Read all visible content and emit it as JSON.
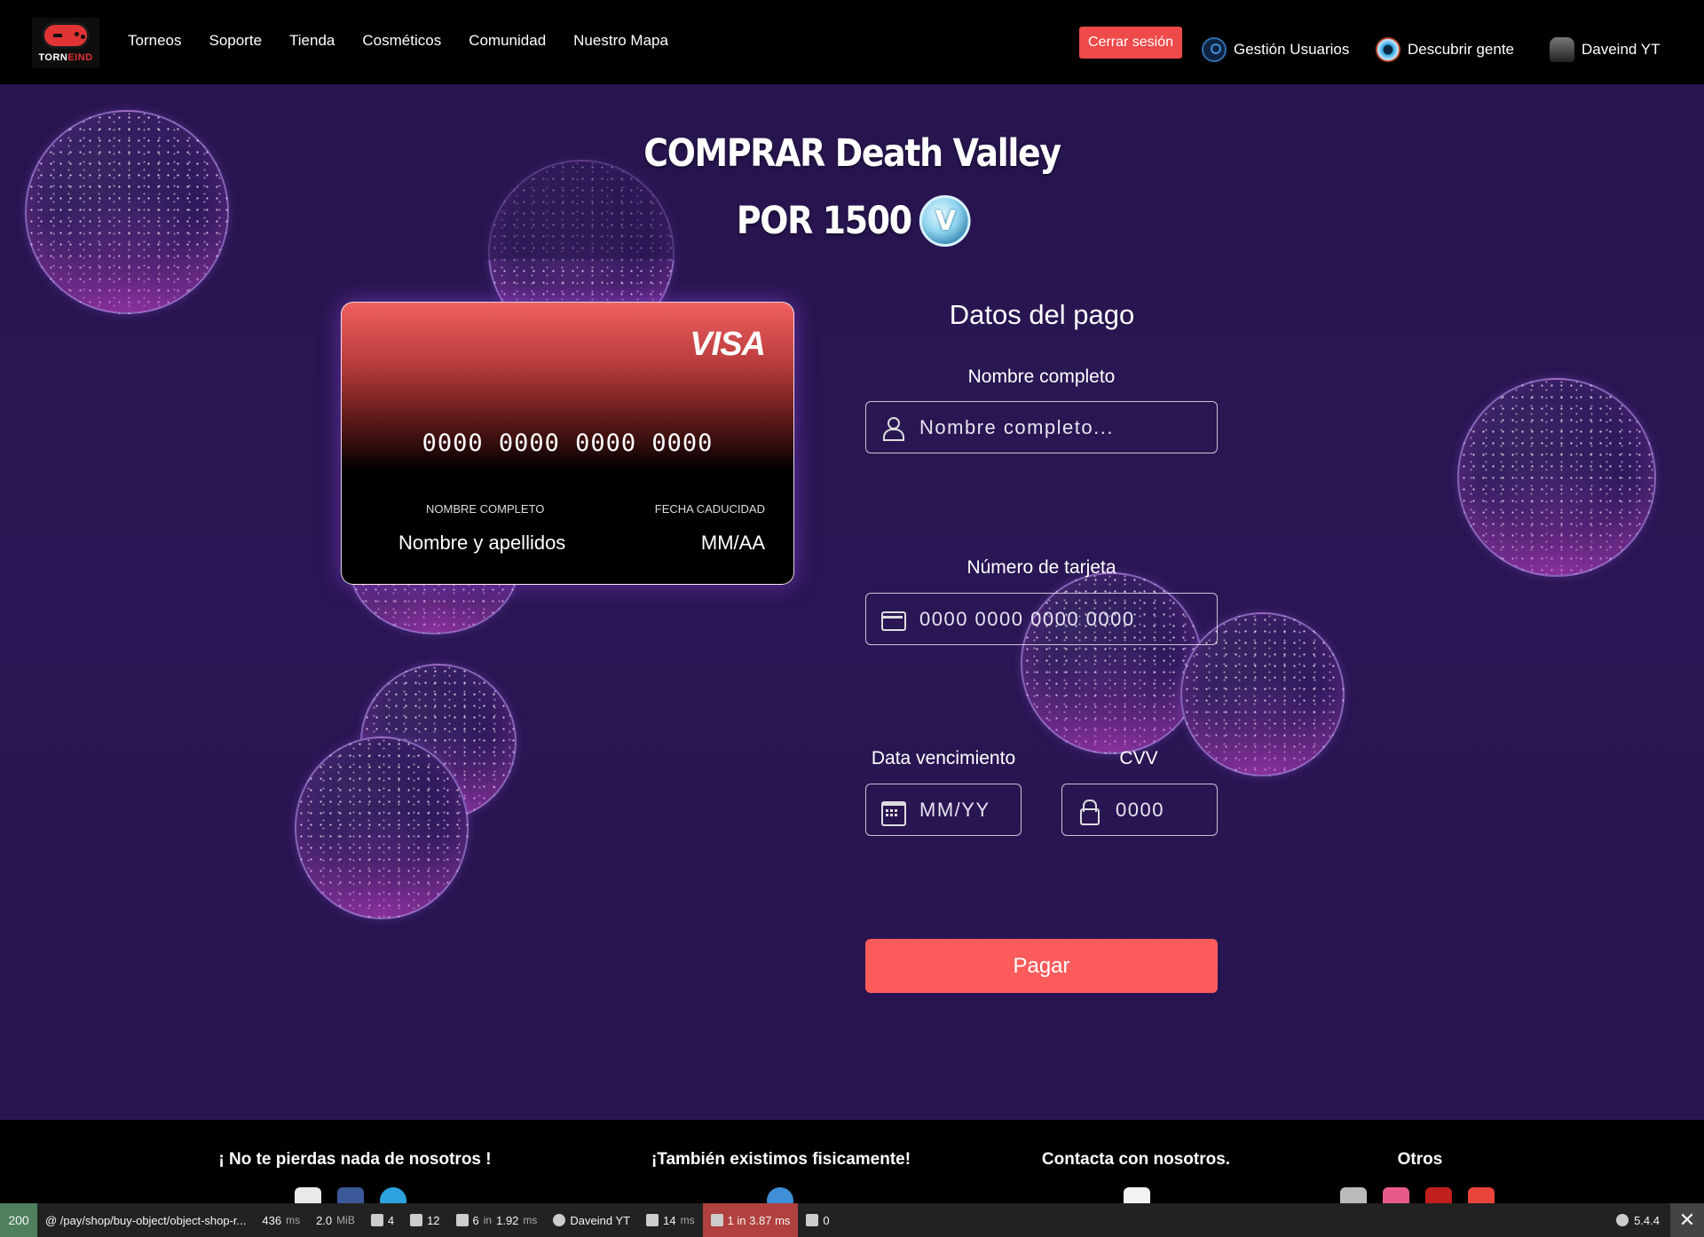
{
  "nav": {
    "logo_text_a": "TORN",
    "logo_text_b": "EIND",
    "links": [
      "Torneos",
      "Soporte",
      "Tienda",
      "Cosméticos",
      "Comunidad",
      "Nuestro Mapa"
    ],
    "logout": "Cerrar sesión",
    "manage_users": "Gestión Usuarios",
    "discover": "Descubrir gente",
    "username": "Daveind YT"
  },
  "hero": {
    "title_line1": "COMPRAR Death Valley",
    "title_line2": "POR 1500",
    "currency_icon": "vbuck-icon",
    "currency_letter": "V"
  },
  "card": {
    "brand": "VISA",
    "number": "0000 0000 0000 0000",
    "name_label": "NOMBRE COMPLETO",
    "expiry_label": "FECHA CADUCIDAD",
    "name_value": "Nombre y apellidos",
    "expiry_value": "MM/AA"
  },
  "form": {
    "title": "Datos del pago",
    "name_label": "Nombre completo",
    "name_placeholder": "Nombre completo...",
    "card_label": "Número de tarjeta",
    "card_placeholder": "0000 0000 0000 0000",
    "expiry_label": "Data vencimiento",
    "expiry_placeholder": "MM/YY",
    "cvv_label": "CVV",
    "cvv_placeholder": "0000",
    "submit": "Pagar"
  },
  "footer": {
    "col1": "¡ No te pierdas nada de nosotros !",
    "col2": "¡También existimos fisicamente!",
    "col3": "Contacta con nosotros.",
    "col4": "Otros"
  },
  "debug": {
    "status": "200",
    "route": "@ /pay/shop/buy-object/object-shop-r...",
    "time": "436",
    "time_unit": "ms",
    "memory": "2.0",
    "memory_unit": "MiB",
    "forms": "4",
    "validator": "12",
    "cache": "6",
    "cache_in": "in",
    "cache_time": "1.92",
    "cache_unit": "ms",
    "user": "Daveind YT",
    "twig": "14",
    "twig_unit": "ms",
    "db": "1 in 3.87 ms",
    "events": "0",
    "version": "5.4.4",
    "close": "✕"
  },
  "colors": {
    "accent": "#fb5b5b",
    "background": "#2a1654",
    "navbar": "#000000",
    "debug_status": "#4f805d",
    "debug_db": "#b0413e"
  }
}
